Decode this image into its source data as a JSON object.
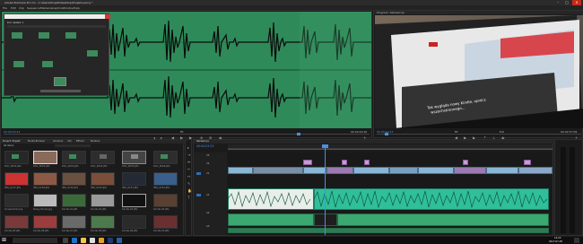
{
  "window": {
    "title": "Adobe Premiere Pro CC - C:\\Users\\Projekt\\Desktop\\Projekt.prproj *",
    "minimize": "–",
    "maximize": "□",
    "close": "×"
  },
  "menu": [
    "File",
    "Edit",
    "Clip",
    "Sequence",
    "Markers",
    "Graphics",
    "Window",
    "Help"
  ],
  "source": {
    "bin_title": "bin nazwa 1",
    "timecode_left": "00:00:03:23",
    "timecode_right": "00:00:44:20",
    "fit": "Fit"
  },
  "program": {
    "tab": "Program: Sekwencja",
    "timecode_left": "00:00:03:23",
    "fit": "Fit",
    "full": "Full",
    "timecode_right": "00:02:27:09",
    "slide_text_line1": "Tak wygląda nowy Kindle, oprócz",
    "slide_text_line2": "wszechstronnego..."
  },
  "project": {
    "tabs": [
      "Project: Projekt",
      "Media Browser",
      "Libraries",
      "Info",
      "Effects",
      "Markers"
    ],
    "item_count": "64 Items",
    "thumb_labels": [
      "DSC_0001.JPG",
      "DSC_0002.JPG",
      "DSC_0003.JPG",
      "DSC_0004.JPG",
      "DSC_0005.JPG",
      "DSC_0006.JPG",
      "IMG_0147.JPG",
      "IMG_0148.JPG",
      "IMG_0149.JPG",
      "IMG_0150.JPG",
      "IMG_0151.JPG",
      "IMG_0152.JPG",
      "Screenshot.png",
      "Nowy-Kindle.jpg",
      "Kindle-01.JPG",
      "Kindle-02.JPG",
      "Kindle-03.JPG",
      "Kindle-04.JPG",
      "Kindle-05.JPG",
      "Kindle-06.JPG",
      "Kindle-07.JPG",
      "Kindle-08.JPG",
      "Kindle-09.JPG",
      "Kindle-10.JPG"
    ]
  },
  "timeline": {
    "tab": "Sekwencja",
    "timecode": "00:00:03:23",
    "tracks": [
      "V3",
      "V2",
      "V1",
      "A1",
      "A2",
      "A3"
    ]
  },
  "taskbar": {
    "time": "14:22",
    "date": "2017-07-05"
  },
  "colors": {
    "waveform_bg": "#2f8a5a",
    "audio_clip": "#2fbf9a",
    "video_clip": "#8ab6d6",
    "pink_clip": "#c89bd6",
    "accent": "#4a90e2"
  }
}
